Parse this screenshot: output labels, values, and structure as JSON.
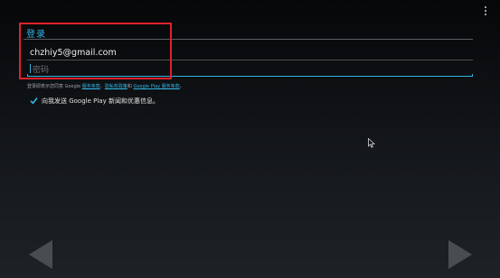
{
  "login": {
    "title": "登录",
    "email_value": "chzhiy5@gmail.com",
    "password_placeholder": "密码"
  },
  "terms": {
    "prefix": "登录即表示您同意 Google ",
    "link_service": "服务条款",
    "sep1": "、",
    "link_privacy": "隐私权政策",
    "sep2": "和 ",
    "link_play": "Google Play 服务条款",
    "suffix": "。"
  },
  "newsletter": {
    "checked": true,
    "label": "向我发送 Google Play 新闻和优惠信息。"
  },
  "icons": {
    "overflow": "overflow-menu-icon",
    "checkbox": "checkmark-icon",
    "cursor": "mouse-pointer-icon",
    "prev": "back-arrow-icon",
    "next": "forward-arrow-icon"
  },
  "colors": {
    "accent": "#33b5e5",
    "highlight_box": "#e0212a",
    "nav_arrow": "#4a4d50"
  }
}
